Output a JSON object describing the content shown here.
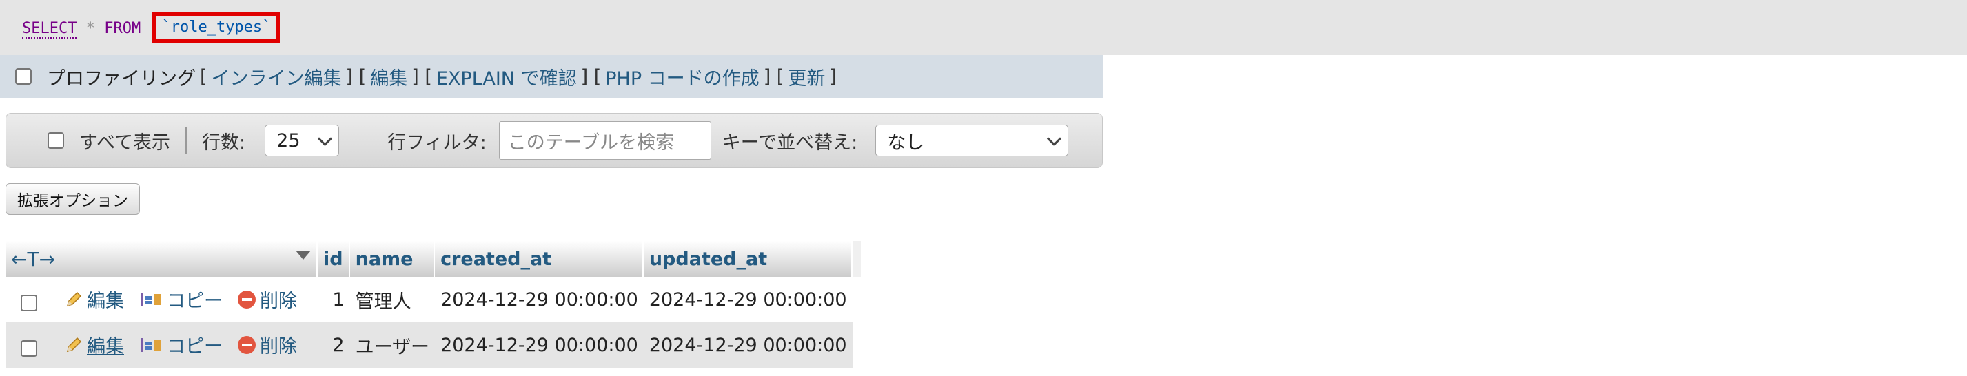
{
  "sql": {
    "select": "SELECT",
    "star": "*",
    "from": "FROM",
    "table": "`role_types`"
  },
  "profile_bar": {
    "profiling_label": "プロファイリング",
    "links": [
      "インライン編集",
      "編集",
      "EXPLAIN で確認",
      "PHP コードの作成",
      "更新"
    ]
  },
  "nav": {
    "show_all_label": "すべて表示",
    "rows_label": "行数:",
    "rows_value": "25",
    "filter_label": "行フィルタ:",
    "filter_placeholder": "このテーブルを検索",
    "sort_label": "キーで並べ替え:",
    "sort_value": "なし"
  },
  "extended_options_label": "拡張オプション",
  "table": {
    "arrows": "←T→",
    "columns": [
      "id",
      "name",
      "created_at",
      "updated_at"
    ],
    "actions": {
      "edit": "編集",
      "copy": "コピー",
      "delete": "削除"
    },
    "rows": [
      {
        "id": "1",
        "name": "管理人",
        "created_at": "2024-12-29 00:00:00",
        "updated_at": "2024-12-29 00:00:00"
      },
      {
        "id": "2",
        "name": "ユーザー",
        "created_at": "2024-12-29 00:00:00",
        "updated_at": "2024-12-29 00:00:00"
      }
    ]
  },
  "colors": {
    "link": "#235a81",
    "highlight_border": "#e00000",
    "delete_icon": "#e2553f"
  }
}
